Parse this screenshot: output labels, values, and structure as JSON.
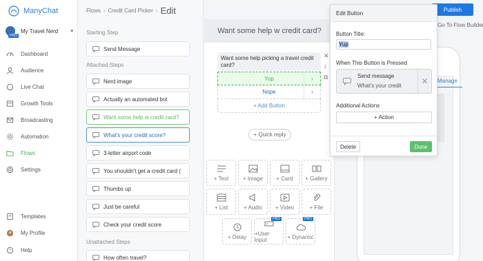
{
  "app": {
    "name": "ManyChat"
  },
  "account": {
    "name": "My Travel Nerd",
    "badge": "PRO"
  },
  "nav": {
    "dashboard": "Dashboard",
    "audience": "Audience",
    "live_chat": "Live Chat",
    "growth_tools": "Growth Tools",
    "broadcasting": "Broadcasting",
    "automation": "Automation",
    "flows": "Flows",
    "settings": "Settings",
    "templates": "Templates",
    "my_profile": "My Profile",
    "help": "Help"
  },
  "breadcrumb": {
    "flows": "Flows",
    "flow": "Credit Card Picker",
    "current": "Edit"
  },
  "steps": {
    "starting_title": "Starting Step",
    "starting": [
      "Send Message"
    ],
    "attached_title": "Attached Steps",
    "attached": [
      "Nerd image",
      "Actually an automated bot",
      "Want some help w credit card?",
      "What's your credit score?",
      "3-letter airport code",
      "You shouldn't get a credit card (",
      "Thumbs up",
      "Just be careful",
      "Check your credit score"
    ],
    "unattached_title": "Unattached Steps",
    "unattached": [
      "How often travel?"
    ]
  },
  "editor": {
    "title": "Want some help w credit card?",
    "message_text": "Want some help picking a travel credit card?",
    "buttons": [
      "Yup",
      "Nope"
    ],
    "add_button": "+ Add Button",
    "quick_reply": "+ Quick reply",
    "tools": [
      {
        "label": "+ Text",
        "icon": "text-icon",
        "pro": ""
      },
      {
        "label": "+ Image",
        "icon": "image-icon",
        "pro": ""
      },
      {
        "label": "+ Card",
        "icon": "card-icon",
        "pro": ""
      },
      {
        "label": "+ Gallery",
        "icon": "gallery-icon",
        "pro": ""
      },
      {
        "label": "+ List",
        "icon": "list-icon",
        "pro": ""
      },
      {
        "label": "+ Audio",
        "icon": "audio-icon",
        "pro": ""
      },
      {
        "label": "+ Video",
        "icon": "video-icon",
        "pro": ""
      },
      {
        "label": "+ File",
        "icon": "file-icon",
        "pro": ""
      },
      {
        "label": "+ Delay",
        "icon": "clock-icon",
        "pro": ""
      },
      {
        "label": "+User Input",
        "icon": "user-input-icon",
        "pro": "PRO"
      },
      {
        "label": "+ Dynamic",
        "icon": "dynamic-icon",
        "pro": "PRO"
      }
    ]
  },
  "header": {
    "publish": "Publish",
    "goto": "Go To Flow Builder",
    "manage": "Manage",
    "preview_letter": "a"
  },
  "popup": {
    "title": "Edit Button",
    "button_title_label": "Button Title:",
    "button_title_value": "Yup",
    "when_pressed_label": "When This Button is Pressed",
    "action_title": "Send message",
    "action_sub": "What's your credit",
    "additional_label": "Additional Actions",
    "add_action": "+ Action",
    "delete": "Delete",
    "done": "Done"
  },
  "colors": {
    "brand": "#2b81d6",
    "active": "#3cb54a",
    "publish": "#1e7ae0",
    "done": "#5cc16a"
  }
}
